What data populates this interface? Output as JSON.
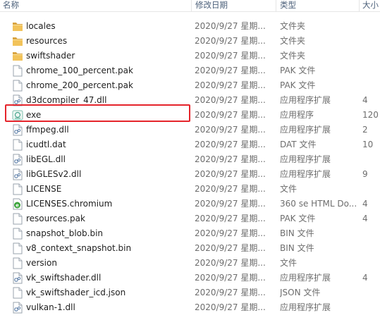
{
  "columns": {
    "name": "名称",
    "date": "修改日期",
    "type": "类型",
    "size": "大小"
  },
  "files": [
    {
      "name": "locales",
      "date": "2020/9/27 星期...",
      "type": "文件夹",
      "size": "",
      "icon": "folder-icon"
    },
    {
      "name": "resources",
      "date": "2020/9/27 星期...",
      "type": "文件夹",
      "size": "",
      "icon": "folder-icon"
    },
    {
      "name": "swiftshader",
      "date": "2020/9/27 星期...",
      "type": "文件夹",
      "size": "",
      "icon": "folder-icon"
    },
    {
      "name": "chrome_100_percent.pak",
      "date": "2020/9/27 星期...",
      "type": "PAK 文件",
      "size": "",
      "icon": "file-icon"
    },
    {
      "name": "chrome_200_percent.pak",
      "date": "2020/9/27 星期...",
      "type": "PAK 文件",
      "size": "",
      "icon": "file-icon"
    },
    {
      "name": "d3dcompiler_47.dll",
      "date": "2020/9/27 星期...",
      "type": "应用程序扩展",
      "size": "4",
      "icon": "dll-icon"
    },
    {
      "name": "exe",
      "date": "2020/9/27 星期...",
      "type": "应用程序",
      "size": "120",
      "icon": "app-icon",
      "highlight": true
    },
    {
      "name": "ffmpeg.dll",
      "date": "2020/9/27 星期...",
      "type": "应用程序扩展",
      "size": "2",
      "icon": "dll-icon"
    },
    {
      "name": "icudtl.dat",
      "date": "2020/9/27 星期...",
      "type": "DAT 文件",
      "size": "10",
      "icon": "file-icon"
    },
    {
      "name": "libEGL.dll",
      "date": "2020/9/27 星期...",
      "type": "应用程序扩展",
      "size": "",
      "icon": "dll-icon"
    },
    {
      "name": "libGLESv2.dll",
      "date": "2020/9/27 星期...",
      "type": "应用程序扩展",
      "size": "9",
      "icon": "dll-icon"
    },
    {
      "name": "LICENSE",
      "date": "2020/9/27 星期...",
      "type": "文件",
      "size": "",
      "icon": "file-icon"
    },
    {
      "name": "LICENSES.chromium",
      "date": "2020/9/27 星期...",
      "type": "360 se HTML Do...",
      "size": "4",
      "icon": "html-icon"
    },
    {
      "name": "resources.pak",
      "date": "2020/9/27 星期...",
      "type": "PAK 文件",
      "size": "4",
      "icon": "file-icon"
    },
    {
      "name": "snapshot_blob.bin",
      "date": "2020/9/27 星期...",
      "type": "BIN 文件",
      "size": "",
      "icon": "file-icon"
    },
    {
      "name": "v8_context_snapshot.bin",
      "date": "2020/9/27 星期...",
      "type": "BIN 文件",
      "size": "",
      "icon": "file-icon"
    },
    {
      "name": "version",
      "date": "2020/9/27 星期...",
      "type": "文件",
      "size": "",
      "icon": "file-icon"
    },
    {
      "name": "vk_swiftshader.dll",
      "date": "2020/9/27 星期...",
      "type": "应用程序扩展",
      "size": "4",
      "icon": "dll-icon"
    },
    {
      "name": "vk_swiftshader_icd.json",
      "date": "2020/9/27 星期...",
      "type": "JSON 文件",
      "size": "",
      "icon": "file-icon"
    },
    {
      "name": "vulkan-1.dll",
      "date": "2020/9/27 星期...",
      "type": "应用程序扩展",
      "size": "",
      "icon": "dll-icon"
    }
  ],
  "colors": {
    "highlight_border": "#e5242b",
    "folder": "#e8b64c",
    "html_icon": "#3aa33a"
  }
}
